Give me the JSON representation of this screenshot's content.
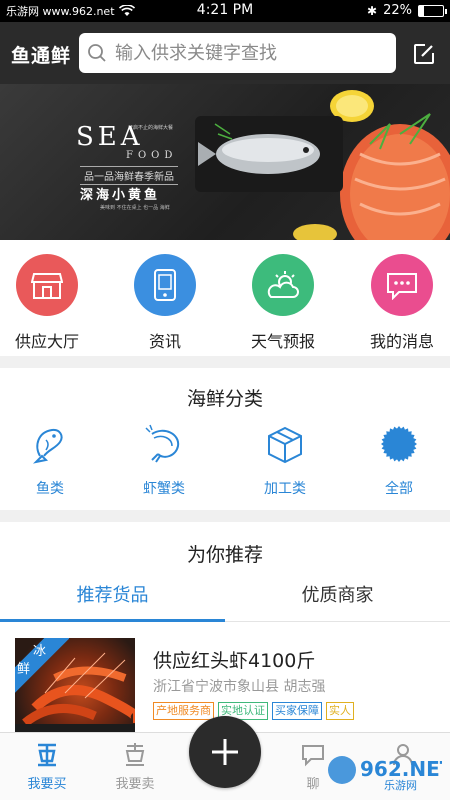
{
  "status_bar": {
    "carrier": "乐游网 www.962.net",
    "time": "4:21 PM",
    "battery": "22%",
    "battery_level": 0.22
  },
  "header": {
    "brand": "鱼通鲜",
    "search_placeholder": "输入供求关键字查找"
  },
  "banner": {
    "sea": "SEA",
    "food": "FOOD",
    "small_note": "开启不止的海鲜大餐",
    "line1": "品一品海鲜春季新品",
    "line2": "深海小黄鱼",
    "line3": "美味到 不住在桌上 也一品 海鲜"
  },
  "quick_links": [
    {
      "label": "供应大厅",
      "icon": "shop-icon",
      "color": "#e9595a"
    },
    {
      "label": "资讯",
      "icon": "phone-news-icon",
      "color": "#3b8fe0"
    },
    {
      "label": "天气预报",
      "icon": "weather-icon",
      "color": "#3dbb7c"
    },
    {
      "label": "我的消息",
      "icon": "message-icon",
      "color": "#ea4d8f"
    }
  ],
  "categories": {
    "title": "海鲜分类",
    "items": [
      {
        "label": "鱼类",
        "icon": "fish-icon"
      },
      {
        "label": "虾蟹类",
        "icon": "shrimp-icon"
      },
      {
        "label": "加工类",
        "icon": "box-icon"
      },
      {
        "label": "全部",
        "icon": "all-badge-icon"
      }
    ]
  },
  "recommend": {
    "title": "为你推荐",
    "tabs": [
      "推荐货品",
      "优质商家"
    ],
    "active_tab": 0,
    "product": {
      "badge_1": "冰",
      "badge_2": "鲜",
      "title": "供应红头虾4100斤",
      "location": "浙江省宁波市象山县   胡志强",
      "tags": [
        {
          "text": "产地服务商",
          "color": "orange"
        },
        {
          "text": "实地认证",
          "color": "green"
        },
        {
          "text": "买家保障",
          "color": "blue"
        },
        {
          "text": "实人",
          "color": "yellow"
        }
      ]
    }
  },
  "tabbar": {
    "items": [
      {
        "label": "我要买",
        "icon": "buy-icon",
        "active": true
      },
      {
        "label": "我要卖",
        "icon": "sell-icon",
        "active": false
      },
      {
        "label": "聊",
        "icon": "chat-icon",
        "active": false
      },
      {
        "label": "",
        "icon": "profile-icon",
        "active": false
      }
    ]
  },
  "watermark": {
    "logo_text": "962.NET",
    "logo_sub": "乐游网"
  },
  "accent": "#2a86d6"
}
